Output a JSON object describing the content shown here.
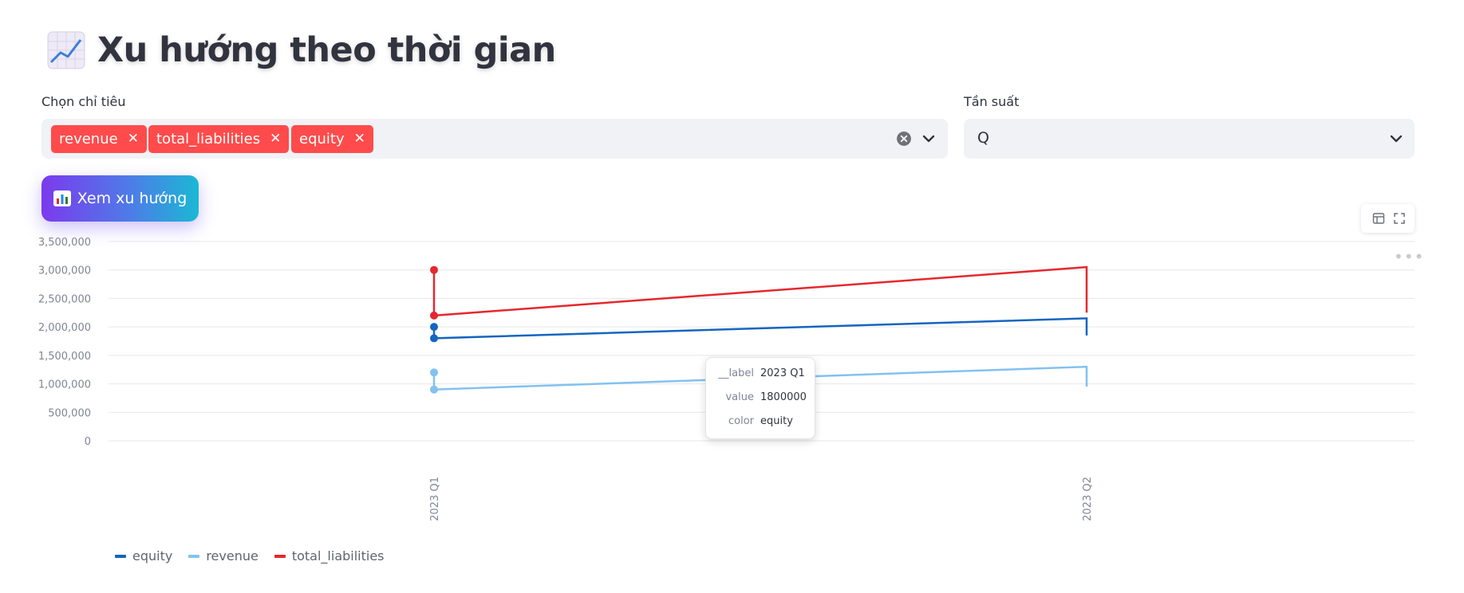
{
  "header": {
    "title": "Xu hướng theo thời gian",
    "icon": "chart-increasing-icon"
  },
  "metric_select": {
    "label": "Chọn chỉ tiêu",
    "selected": [
      {
        "label": "revenue"
      },
      {
        "label": "total_liabilities"
      },
      {
        "label": "equity"
      }
    ],
    "clear_icon": "clear-icon",
    "dropdown_icon": "chevron-down-icon"
  },
  "frequency_select": {
    "label": "Tần suất",
    "value": "Q",
    "dropdown_icon": "chevron-down-icon"
  },
  "action_button": {
    "label": "Xem xu hướng",
    "icon": "bar-chart-icon"
  },
  "chart_toolbar": {
    "icons": [
      "table-icon",
      "fullscreen-icon",
      "more-icon"
    ]
  },
  "tooltip": {
    "rows": [
      {
        "key": "__label",
        "value": "2023 Q1"
      },
      {
        "key": "value",
        "value": "1800000"
      },
      {
        "key": "color",
        "value": "equity"
      }
    ]
  },
  "colors": {
    "accent": "#ff4b4b",
    "equity": "#1565c0",
    "revenue": "#83c1f0",
    "total_liabilities": "#e5282e"
  },
  "chart_data": {
    "type": "line",
    "x": [
      "2023 Q1",
      "2023 Q2"
    ],
    "ylim": [
      0,
      3500000
    ],
    "y_ticks": [
      0,
      500000,
      1000000,
      1500000,
      2000000,
      2500000,
      3000000,
      3500000
    ],
    "y_tick_labels": [
      "0",
      "500,000",
      "1,000,000",
      "1,500,000",
      "2,000,000",
      "2,500,000",
      "3,000,000",
      "3,500,000"
    ],
    "grid": true,
    "legend": "bottom-left",
    "series": [
      {
        "name": "equity",
        "color": "#1565c0",
        "points": [
          [
            "2023 Q1",
            2000000
          ],
          [
            "2023 Q1",
            1800000
          ],
          [
            "2023 Q2",
            2150000
          ],
          [
            "2023 Q2",
            1850000
          ]
        ]
      },
      {
        "name": "revenue",
        "color": "#83c1f0",
        "points": [
          [
            "2023 Q1",
            1200000
          ],
          [
            "2023 Q1",
            900000
          ],
          [
            "2023 Q2",
            1300000
          ],
          [
            "2023 Q2",
            950000
          ]
        ]
      },
      {
        "name": "total_liabilities",
        "color": "#e5282e",
        "points": [
          [
            "2023 Q1",
            3000000
          ],
          [
            "2023 Q1",
            2200000
          ],
          [
            "2023 Q2",
            3050000
          ],
          [
            "2023 Q2",
            2250000
          ]
        ]
      }
    ]
  }
}
